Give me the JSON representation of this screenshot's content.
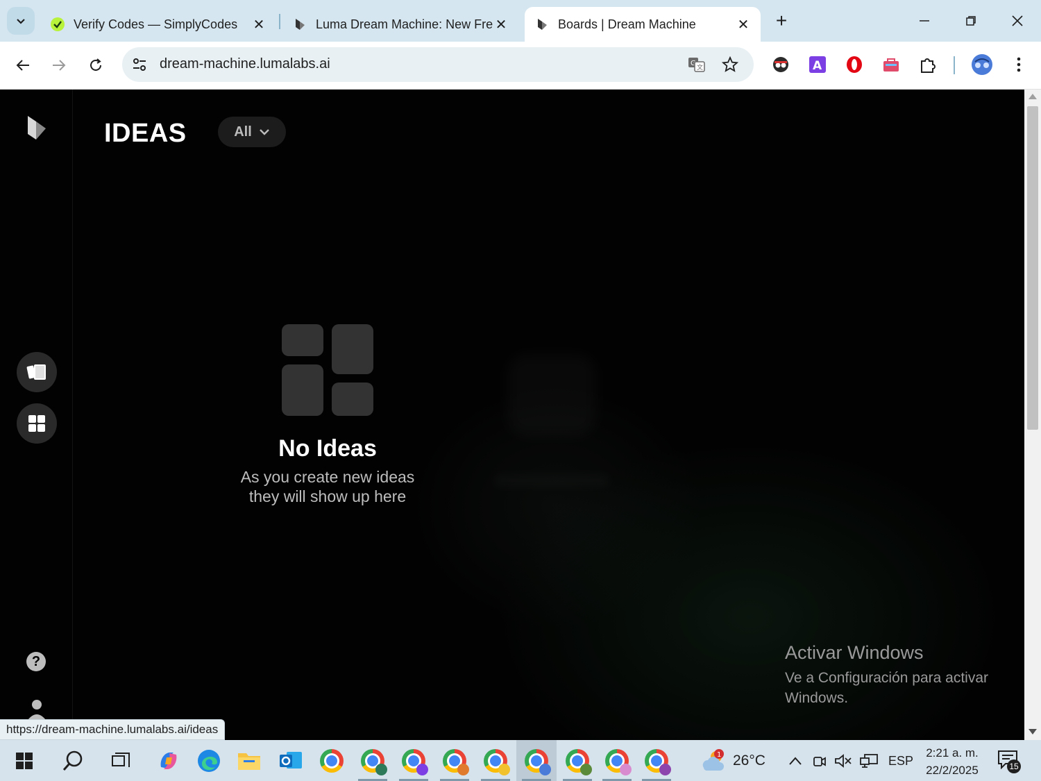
{
  "browser": {
    "tabs": [
      {
        "title": "Verify Codes — SimplyCodes",
        "favicon": "simplycodes-icon"
      },
      {
        "title": "Luma Dream Machine: New Fre",
        "favicon": "luma-icon"
      },
      {
        "title": "Boards | Dream Machine",
        "favicon": "luma-icon",
        "active": true
      }
    ],
    "address": "dream-machine.lumalabs.ai",
    "status_url": "https://dream-machine.lumalabs.ai/ideas"
  },
  "page": {
    "heading": "IDEAS",
    "filter_label": "All",
    "empty_title": "No Ideas",
    "empty_subtitle_line1": "As you create new ideas",
    "empty_subtitle_line2": "they will show up here"
  },
  "watermark": {
    "title": "Activar Windows",
    "line1": "Ve a Configuración para activar",
    "line2": "Windows."
  },
  "taskbar": {
    "temperature": "26°C",
    "weather_badge": "1",
    "language": "ESP",
    "time": "2:21 a. m.",
    "date": "22/2/2025",
    "notifications": "15"
  },
  "colors": {
    "tabbar_bg": "#d5e6f0",
    "page_bg": "#020202",
    "taskbar_bg": "#d7e3ec",
    "accent_profile": "#4a7bd8"
  }
}
